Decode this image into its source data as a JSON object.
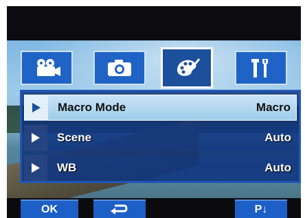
{
  "tabs": [
    {
      "icon": "video-camera-icon",
      "active": false
    },
    {
      "icon": "camera-icon",
      "active": false
    },
    {
      "icon": "palette-icon",
      "active": true
    },
    {
      "icon": "tools-icon",
      "active": false
    }
  ],
  "menu": {
    "items": [
      {
        "label": "Macro Mode",
        "value": "Macro",
        "selected": true
      },
      {
        "label": "Scene",
        "value": "Auto",
        "selected": false
      },
      {
        "label": "WB",
        "value": "Auto",
        "selected": false
      }
    ]
  },
  "softkeys": {
    "ok_label": "OK",
    "back_icon": "return-arrow-icon",
    "page_label": "P↓"
  },
  "colors": {
    "tab_blue": "#1f63c6",
    "selected_row": "#a9d4ee",
    "softkey_blue": "#1c5fc6"
  }
}
